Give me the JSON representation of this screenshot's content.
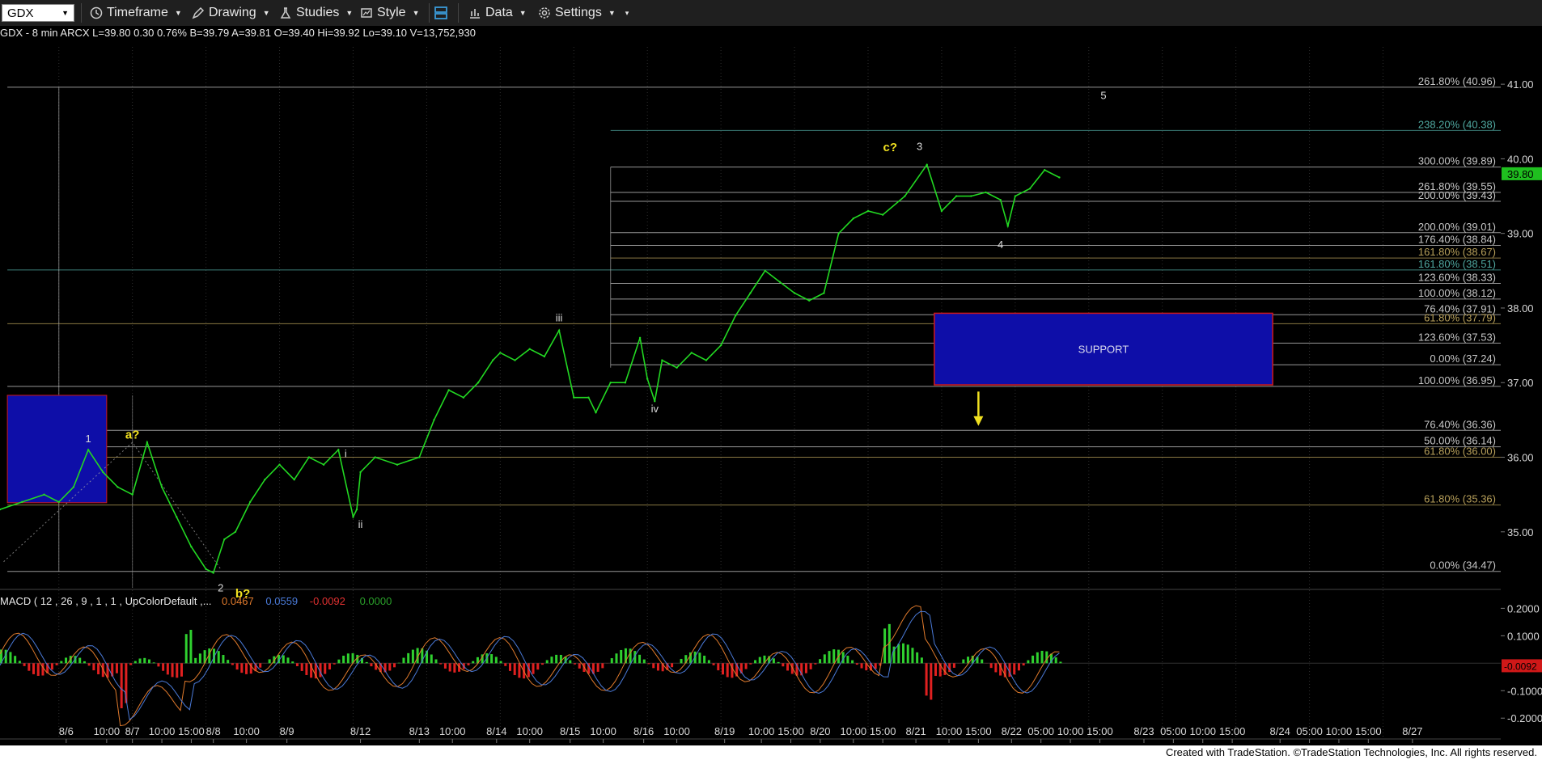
{
  "toolbar": {
    "symbol": "GDX",
    "timeframe_label": "Timeframe",
    "drawing_label": "Drawing",
    "studies_label": "Studies",
    "style_label": "Style",
    "data_label": "Data",
    "settings_label": "Settings"
  },
  "header": {
    "info": "GDX - 8 min  ARCX  L=39.80  0.30   0.76%   B=39.79  A=39.81  O=39.40  Hi=39.92  Lo=39.10  V=13,752,930",
    "last_price": "39.80"
  },
  "price_axis": {
    "ticks": [
      "41.00",
      "40.00",
      "39.00",
      "38.00",
      "37.00",
      "36.00",
      "35.00"
    ],
    "values": [
      41,
      40,
      39,
      38,
      37,
      36,
      35
    ],
    "range": [
      34.25,
      41.5
    ]
  },
  "fib_labels": [
    {
      "text": "261.80% (40.96)",
      "y": 40.96,
      "color": "#c8c8c8"
    },
    {
      "text": "238.20% (40.38)",
      "y": 40.38,
      "color": "#4fa8a0"
    },
    {
      "text": "300.00% (39.89)",
      "y": 39.89,
      "color": "#c8c8c8"
    },
    {
      "text": "261.80% (39.55)",
      "y": 39.55,
      "color": "#c8c8c8"
    },
    {
      "text": "200.00% (39.43)",
      "y": 39.43,
      "color": "#c8c8c8"
    },
    {
      "text": "200.00% (39.01)",
      "y": 39.01,
      "color": "#c8c8c8"
    },
    {
      "text": "176.40% (38.84)",
      "y": 38.84,
      "color": "#c8c8c8"
    },
    {
      "text": "161.80% (38.67)",
      "y": 38.67,
      "color": "#b8a05a"
    },
    {
      "text": "161.80% (38.51)",
      "y": 38.51,
      "color": "#4fa8a0"
    },
    {
      "text": "123.60% (38.33)",
      "y": 38.33,
      "color": "#c8c8c8"
    },
    {
      "text": "100.00% (38.12)",
      "y": 38.12,
      "color": "#c8c8c8"
    },
    {
      "text": "76.40% (37.91)",
      "y": 37.91,
      "color": "#c8c8c8"
    },
    {
      "text": "61.80% (37.79)",
      "y": 37.79,
      "color": "#b8a05a"
    },
    {
      "text": "123.60% (37.53)",
      "y": 37.53,
      "color": "#c8c8c8"
    },
    {
      "text": "0.00% (37.24)",
      "y": 37.24,
      "color": "#c8c8c8"
    },
    {
      "text": "100.00% (36.95)",
      "y": 36.95,
      "color": "#c8c8c8"
    },
    {
      "text": "76.40% (36.36)",
      "y": 36.36,
      "color": "#c8c8c8"
    },
    {
      "text": "50.00% (36.14)",
      "y": 36.14,
      "color": "#c8c8c8"
    },
    {
      "text": "61.80% (36.00)",
      "y": 36.0,
      "color": "#b8a05a"
    },
    {
      "text": "61.80% (35.36)",
      "y": 35.36,
      "color": "#b8a05a"
    },
    {
      "text": "0.00% (34.47)",
      "y": 34.47,
      "color": "#c8c8c8"
    }
  ],
  "wave_labels": [
    {
      "text": "1",
      "x": 0.4,
      "y": 36.2,
      "color": "#dcdcdc"
    },
    {
      "text": "a?",
      "x": 1.0,
      "y": 36.25,
      "color": "#f0e020"
    },
    {
      "text": "2",
      "x": 2.2,
      "y": 34.2,
      "color": "#dcdcdc"
    },
    {
      "text": "b?",
      "x": 2.5,
      "y": 34.12,
      "color": "#f0e020"
    },
    {
      "text": "i",
      "x": 3.9,
      "y": 36.0,
      "color": "#dcdcdc"
    },
    {
      "text": "ii",
      "x": 4.1,
      "y": 35.05,
      "color": "#dcdcdc"
    },
    {
      "text": "iii",
      "x": 6.8,
      "y": 37.82,
      "color": "#dcdcdc"
    },
    {
      "text": "iv",
      "x": 8.1,
      "y": 36.6,
      "color": "#dcdcdc"
    },
    {
      "text": "c?",
      "x": 11.3,
      "y": 40.1,
      "color": "#f0e020"
    },
    {
      "text": "3",
      "x": 11.7,
      "y": 40.12,
      "color": "#dcdcdc"
    },
    {
      "text": "4",
      "x": 12.8,
      "y": 38.8,
      "color": "#dcdcdc"
    },
    {
      "text": "5",
      "x": 14.2,
      "y": 40.8,
      "color": "#dcdcdc"
    }
  ],
  "support": {
    "label": "SUPPORT",
    "top": 37.93,
    "bottom": 36.97,
    "x_from": 11.9,
    "x_to": 16.5
  },
  "left_box": {
    "top": 36.83,
    "bottom": 35.39,
    "x_from": -0.7,
    "x_to": 0.65
  },
  "macd": {
    "label": "MACD ( 12 , 26 , 9 , 1 , 1 , UpColorDefault ,...",
    "values": [
      "0.0467",
      "0.0559",
      "-0.0092",
      "0.0000"
    ],
    "value_colors": [
      "#e07a2c",
      "#4a7ad8",
      "#e03030",
      "#2aa02a"
    ],
    "current": "-0.0092",
    "ticks": [
      "0.2000",
      "0.1000",
      "-0.1000",
      "-0.2000"
    ],
    "tick_values": [
      0.2,
      0.1,
      -0.1,
      -0.2
    ],
    "range": [
      -0.27,
      0.26
    ]
  },
  "time_axis": {
    "labels": [
      "8/6",
      "10:00",
      "8/7",
      "10:00",
      "15:00",
      "8/8",
      "10:00",
      "8/9",
      "8/12",
      "8/13",
      "10:00",
      "8/14",
      "10:00",
      "8/15",
      "10:00",
      "8/16",
      "10:00",
      "8/19",
      "10:00",
      "15:00",
      "8/20",
      "10:00",
      "15:00",
      "8/21",
      "10:00",
      "15:00",
      "8/22",
      "05:00",
      "10:00",
      "15:00",
      "8/23",
      "05:00",
      "10:00",
      "15:00",
      "8/24",
      "05:00",
      "10:00",
      "15:00",
      "8/27"
    ]
  },
  "colors": {
    "price_line": "#22d822",
    "support_fill": "#0e0ea8",
    "support_border": "#d01818",
    "arrow": "#f0e020",
    "last_price_bg": "#1fbf1f",
    "macd_current_bg": "#d01818"
  },
  "chart_data": {
    "type": "line",
    "title": "GDX - 8 min",
    "xlabel": "",
    "ylabel": "",
    "ylim": [
      34.25,
      41.5
    ],
    "series": [
      {
        "x": [
          -0.8,
          -0.5,
          -0.2,
          0.0,
          0.2,
          0.4,
          0.6,
          0.8,
          1.0,
          1.2,
          1.4,
          1.6,
          1.8,
          2.0,
          2.1,
          2.25,
          2.4,
          2.6,
          2.8,
          3.0,
          3.2,
          3.4,
          3.6,
          3.8,
          4.0,
          4.05,
          4.1,
          4.3,
          4.6,
          4.9,
          5.1,
          5.3,
          5.5,
          5.7,
          5.9,
          6.0,
          6.2,
          6.4,
          6.6,
          6.8,
          7.0,
          7.2,
          7.3,
          7.5,
          7.7,
          7.9,
          8.0,
          8.1,
          8.2,
          8.4,
          8.6,
          8.8,
          9.0,
          9.2,
          9.4,
          9.6,
          9.8,
          10.0,
          10.2,
          10.4,
          10.6,
          10.8,
          11.0,
          11.2,
          11.5,
          11.8,
          12.0,
          12.2,
          12.4,
          12.6,
          12.8,
          12.9,
          13.0,
          13.2,
          13.4,
          13.6
        ],
        "y": [
          35.3,
          35.4,
          35.5,
          35.4,
          35.6,
          36.1,
          35.8,
          35.6,
          35.5,
          36.2,
          35.6,
          35.2,
          34.8,
          34.5,
          34.45,
          34.9,
          35.0,
          35.4,
          35.7,
          35.9,
          35.7,
          36.0,
          35.9,
          36.1,
          35.2,
          35.3,
          35.8,
          36.0,
          35.9,
          36.0,
          36.5,
          36.9,
          36.8,
          37.0,
          37.3,
          37.4,
          37.3,
          37.45,
          37.35,
          37.7,
          36.8,
          36.8,
          36.6,
          37.0,
          37.0,
          37.6,
          37.05,
          36.75,
          37.3,
          37.2,
          37.4,
          37.3,
          37.5,
          37.9,
          38.2,
          38.5,
          38.35,
          38.2,
          38.1,
          38.2,
          39.0,
          39.2,
          39.3,
          39.25,
          39.5,
          39.92,
          39.3,
          39.5,
          39.5,
          39.55,
          39.45,
          39.1,
          39.5,
          39.6,
          39.85,
          39.75
        ]
      }
    ]
  }
}
